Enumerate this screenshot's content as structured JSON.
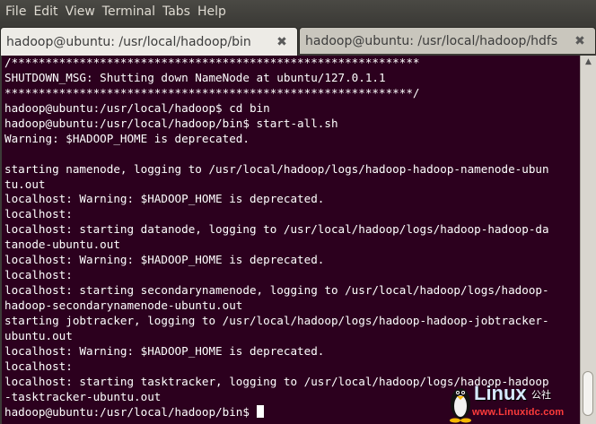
{
  "menu": {
    "items": [
      "File",
      "Edit",
      "View",
      "Terminal",
      "Tabs",
      "Help"
    ]
  },
  "tabs": [
    {
      "label": "hadoop@ubuntu: /usr/local/hadoop/bin",
      "close_icon": "close-icon",
      "close_glyph": "✖",
      "active": true
    },
    {
      "label": "hadoop@ubuntu: /usr/local/hadoop/hdfs",
      "close_icon": "close-icon",
      "close_glyph": "✖",
      "active": false
    }
  ],
  "terminal": {
    "lines": [
      "/************************************************************",
      "SHUTDOWN_MSG: Shutting down NameNode at ubuntu/127.0.1.1",
      "************************************************************/",
      "hadoop@ubuntu:/usr/local/hadoop$ cd bin",
      "hadoop@ubuntu:/usr/local/hadoop/bin$ start-all.sh",
      "Warning: $HADOOP_HOME is deprecated.",
      "",
      "starting namenode, logging to /usr/local/hadoop/logs/hadoop-hadoop-namenode-ubun",
      "tu.out",
      "localhost: Warning: $HADOOP_HOME is deprecated.",
      "localhost:",
      "localhost: starting datanode, logging to /usr/local/hadoop/logs/hadoop-hadoop-da",
      "tanode-ubuntu.out",
      "localhost: Warning: $HADOOP_HOME is deprecated.",
      "localhost:",
      "localhost: starting secondarynamenode, logging to /usr/local/hadoop/logs/hadoop-",
      "hadoop-secondarynamenode-ubuntu.out",
      "starting jobtracker, logging to /usr/local/hadoop/logs/hadoop-hadoop-jobtracker-",
      "ubuntu.out",
      "localhost: Warning: $HADOOP_HOME is deprecated.",
      "localhost:",
      "localhost: starting tasktracker, logging to /usr/local/hadoop/logs/hadoop-hadoop",
      "-tasktracker-ubuntu.out"
    ],
    "prompt": "hadoop@ubuntu:/usr/local/hadoop/bin$ ",
    "colors": {
      "background": "#2c001e",
      "foreground": "#ffffff"
    }
  },
  "watermark": {
    "brand": "Linux",
    "cn_text": "公社",
    "url": "www.Linuxidc.com",
    "icon": "tux-penguin-icon"
  }
}
